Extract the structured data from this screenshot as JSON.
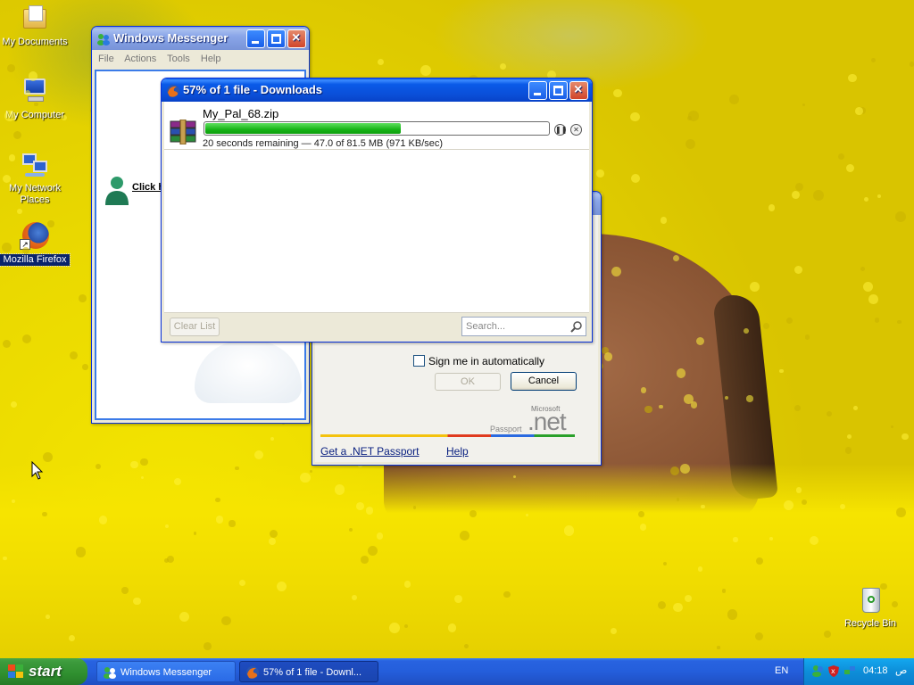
{
  "desktop": {
    "icons": [
      {
        "label": "My Documents"
      },
      {
        "label": "My Computer"
      },
      {
        "label": "My Network Places"
      },
      {
        "label": "Mozilla Firefox"
      },
      {
        "label": "Recycle Bin"
      }
    ]
  },
  "messenger": {
    "title": "Windows Messenger",
    "menu": [
      "File",
      "Actions",
      "Tools",
      "Help"
    ],
    "click_text": "Click h"
  },
  "passport": {
    "sign_in_auto": "Sign me in automatically",
    "ok": "OK",
    "cancel": "Cancel",
    "brand_small": "Microsoft",
    "brand_net": ".net",
    "brand_passport": "Passport",
    "get_passport": "Get a .NET Passport",
    "help": "Help"
  },
  "downloads": {
    "title": "57% of 1 file - Downloads",
    "item": {
      "filename": "My_Pal_68.zip",
      "progress": 0.57,
      "status": "20 seconds remaining — 47.0 of 81.5 MB (971 KB/sec)"
    },
    "clear_list": "Clear List",
    "search_placeholder": "Search..."
  },
  "taskbar": {
    "start": "start",
    "tasks": [
      "Windows Messenger",
      "57% of 1 file - Downl..."
    ],
    "language": "EN",
    "clock_time": "04:18",
    "clock_suffix": "ص"
  },
  "colors": {
    "titlebar_active": "#0a5ae8",
    "progress_green": "#17b417",
    "field_yellow": "#e8d600"
  }
}
